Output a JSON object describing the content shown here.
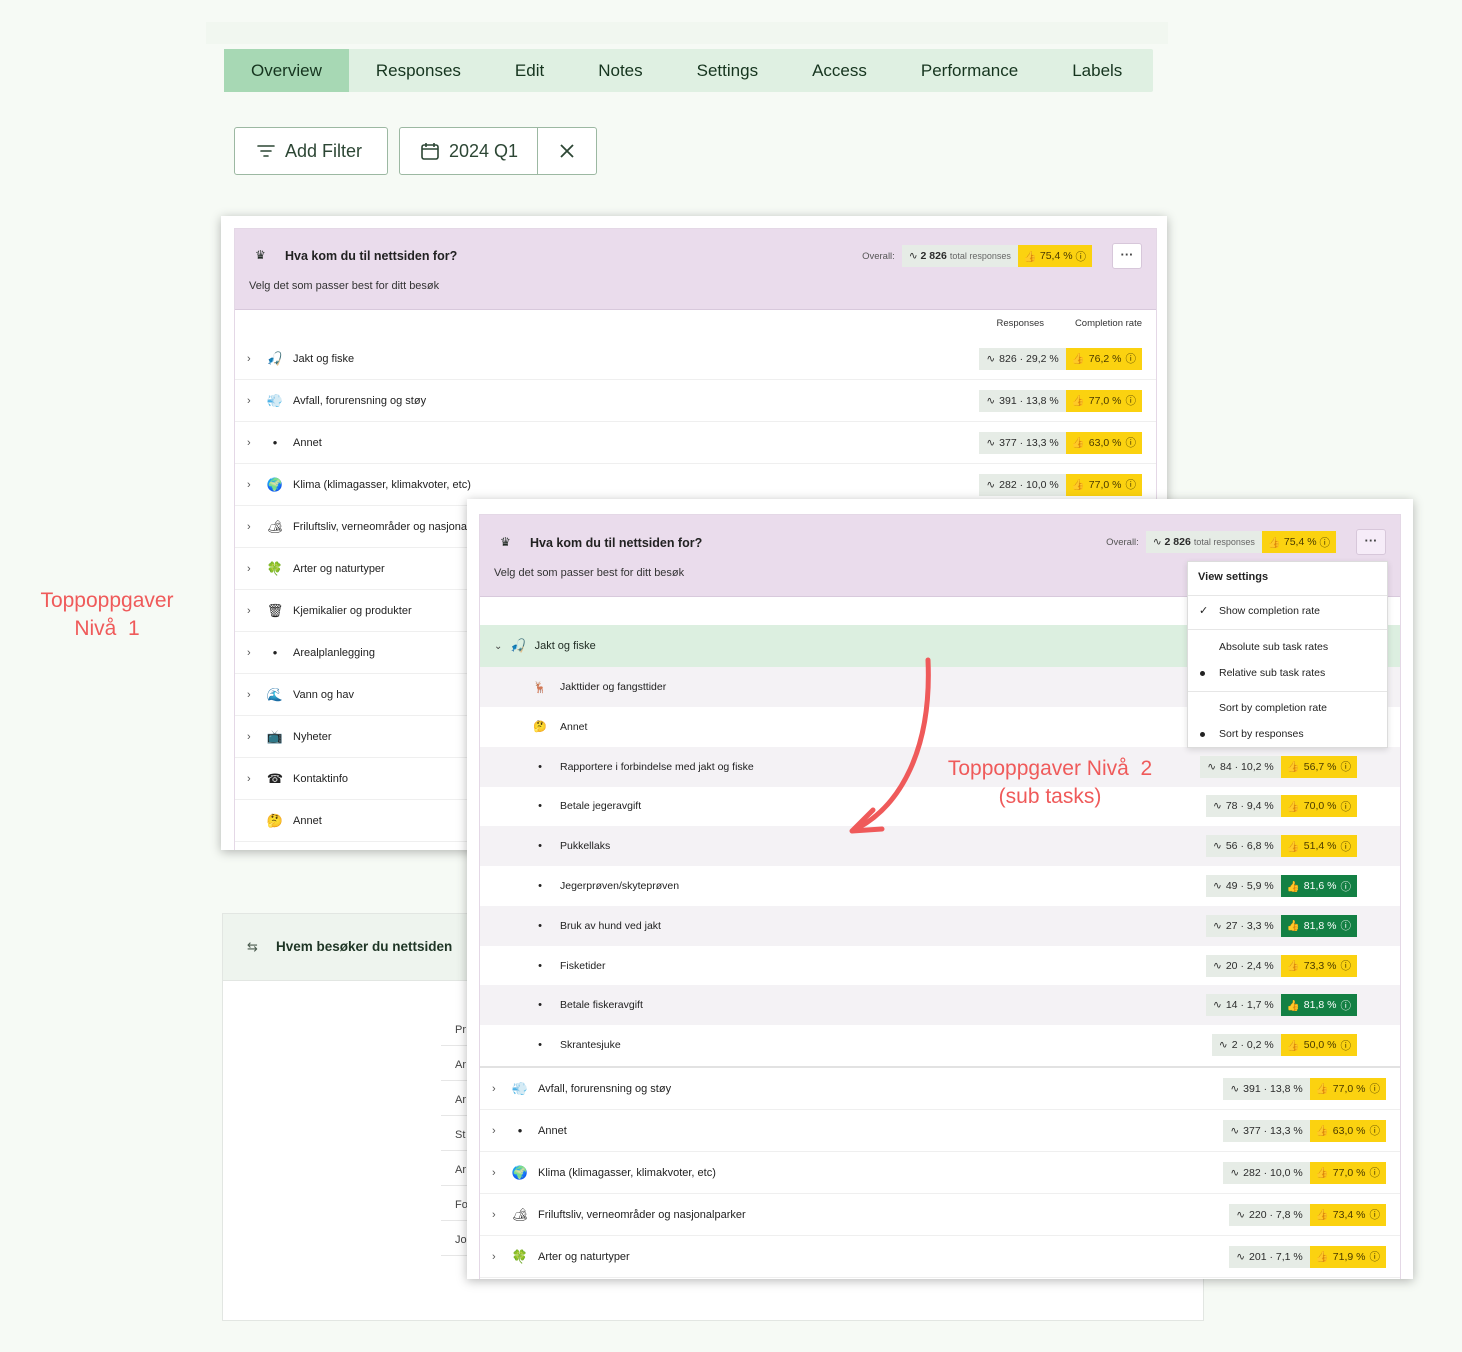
{
  "tabs": [
    "Overview",
    "Responses",
    "Edit",
    "Notes",
    "Settings",
    "Access",
    "Performance",
    "Labels"
  ],
  "filter": {
    "add_label": "Add Filter",
    "date_label": "2024 Q1"
  },
  "panel1": {
    "title": "Hva kom du til nettsiden for?",
    "subtitle": "Velg det som passer best for ditt besøk",
    "overall_label": "Overall:",
    "overall_count": "2 826",
    "overall_suffix": "total responses",
    "overall_rate": "75,4 %",
    "col_responses": "Responses",
    "col_completion": "Completion rate",
    "rows": [
      {
        "icon": "🎣",
        "label": "Jakt og fiske",
        "resp": "826 · 29,2 %",
        "rate": "76,2 %"
      },
      {
        "icon": "💨",
        "label": "Avfall, forurensning og støy",
        "resp": "391 · 13,8 %",
        "rate": "77,0 %"
      },
      {
        "icon": "•",
        "label": "Annet",
        "resp": "377 · 13,3 %",
        "rate": "63,0 %"
      },
      {
        "icon": "🌍",
        "label": "Klima (klimagasser, klimakvoter, etc)",
        "resp": "282 · 10,0 %",
        "rate": "77,0 %"
      },
      {
        "icon": "🏕",
        "label": "Friluftsliv, verneområder og nasjonalparker",
        "resp": "",
        "rate": ""
      },
      {
        "icon": "🍀",
        "label": "Arter og naturtyper",
        "resp": "",
        "rate": ""
      },
      {
        "icon": "🗑",
        "label": "Kjemikalier og produkter",
        "resp": "",
        "rate": ""
      },
      {
        "icon": "•",
        "label": "Arealplanlegging",
        "resp": "",
        "rate": ""
      },
      {
        "icon": "🌊",
        "label": "Vann og hav",
        "resp": "",
        "rate": ""
      },
      {
        "icon": "📺",
        "label": "Nyheter",
        "resp": "",
        "rate": ""
      },
      {
        "icon": "☎",
        "label": "Kontaktinfo",
        "resp": "",
        "rate": ""
      },
      {
        "icon": "🤔",
        "label": "Annet",
        "resp": "",
        "rate": ""
      }
    ]
  },
  "panel2": {
    "title": "Hva kom du til nettsiden for?",
    "subtitle": "Velg det som passer best for ditt besøk",
    "overall_label": "Overall:",
    "overall_count": "2 826",
    "overall_suffix": "total responses",
    "overall_rate": "75,4 %",
    "expanded": {
      "icon": "🎣",
      "label": "Jakt og fiske"
    },
    "subrows": [
      {
        "icon": "🦌",
        "label": "Jakttider og fangsttider",
        "resp": "",
        "rate": "",
        "good": false
      },
      {
        "icon": "🤔",
        "label": "Annet",
        "resp": "",
        "rate": "",
        "good": false
      },
      {
        "icon": "•",
        "label": "Rapportere i forbindelse med jakt og fiske",
        "resp": "84 · 10,2 %",
        "rate": "56,7 %",
        "good": false
      },
      {
        "icon": "•",
        "label": "Betale jegeravgift",
        "resp": "78 · 9,4 %",
        "rate": "70,0 %",
        "good": false
      },
      {
        "icon": "•",
        "label": "Pukkellaks",
        "resp": "56 · 6,8 %",
        "rate": "51,4 %",
        "good": false
      },
      {
        "icon": "•",
        "label": "Jegerprøven/skyteprøven",
        "resp": "49 · 5,9 %",
        "rate": "81,6 %",
        "good": true
      },
      {
        "icon": "•",
        "label": "Bruk av hund ved jakt",
        "resp": "27 · 3,3 %",
        "rate": "81,8 %",
        "good": true
      },
      {
        "icon": "•",
        "label": "Fisketider",
        "resp": "20 · 2,4 %",
        "rate": "73,3 %",
        "good": false
      },
      {
        "icon": "•",
        "label": "Betale fiskeravgift",
        "resp": "14 · 1,7 %",
        "rate": "81,8 %",
        "good": true
      },
      {
        "icon": "•",
        "label": "Skrantesjuke",
        "resp": "2 · 0,2 %",
        "rate": "50,0 %",
        "good": false
      }
    ],
    "rows": [
      {
        "icon": "💨",
        "label": "Avfall, forurensning og støy",
        "resp": "391 · 13,8 %",
        "rate": "77,0 %"
      },
      {
        "icon": "•",
        "label": "Annet",
        "resp": "377 · 13,3 %",
        "rate": "63,0 %"
      },
      {
        "icon": "🌍",
        "label": "Klima (klimagasser, klimakvoter, etc)",
        "resp": "282 · 10,0 %",
        "rate": "77,0 %"
      },
      {
        "icon": "🏕",
        "label": "Friluftsliv, verneområder og nasjonalparker",
        "resp": "220 · 7,8 %",
        "rate": "73,4 %"
      },
      {
        "icon": "🍀",
        "label": "Arter og naturtyper",
        "resp": "201 · 7,1 %",
        "rate": "71,9 %"
      }
    ]
  },
  "menu": {
    "heading": "View settings",
    "show_completion": "Show completion rate",
    "absolute": "Absolute sub task rates",
    "relative": "Relative sub task rates",
    "sort_completion": "Sort by completion rate",
    "sort_responses": "Sort by responses"
  },
  "annotations": {
    "level1_a": "Toppoppgaver",
    "level1_b": "Nivå  1",
    "level2_a": "Toppoppgaver Nivå  2",
    "level2_b": "(sub tasks)"
  },
  "panel3": {
    "title": "Hvem besøker du nettsiden",
    "truncated": [
      "Pr",
      "Ar",
      "Ar",
      "St",
      "Ar",
      "Fo",
      "Jo"
    ]
  },
  "colors": {
    "accent_tab": "#a7d8b4",
    "yellow": "#fbd210",
    "green": "#138044",
    "annotation": "#ef5a5a"
  }
}
